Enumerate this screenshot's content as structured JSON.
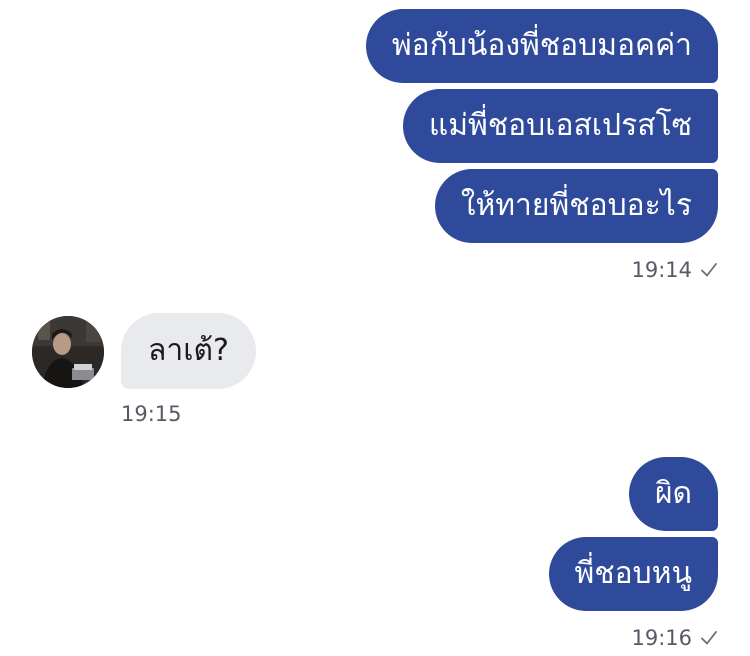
{
  "group1": {
    "messages": [
      "พ่อกับน้องพี่ชอบมอคค่า",
      "แม่พี่ชอบเอสเปรสโซ",
      "ให้ทายพี่ชอบอะไร"
    ],
    "time": "19:14"
  },
  "incoming": {
    "message": "ลาเต้?",
    "time": "19:15"
  },
  "group2": {
    "messages": [
      "ผิด",
      "พี่ชอบหนู"
    ],
    "time": "19:16"
  },
  "colors": {
    "outgoing_bubble": "#2f4a9a",
    "incoming_bubble": "#e9eaee"
  },
  "icons": {
    "read_receipt": "checkmark-icon"
  }
}
